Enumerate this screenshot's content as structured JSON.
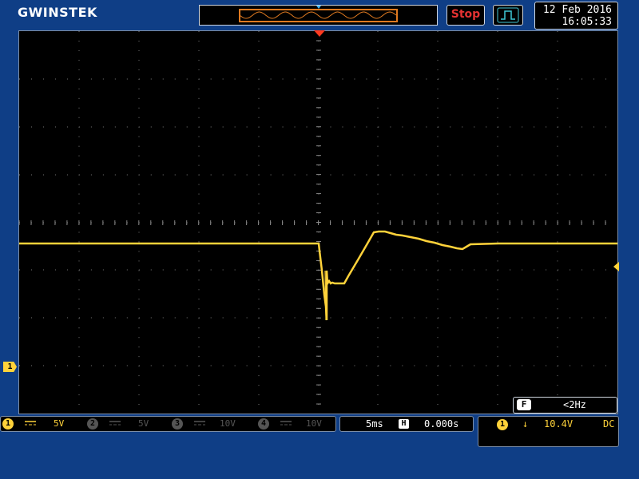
{
  "brand": {
    "logo_text": "GWINSTEK"
  },
  "run_state": {
    "label": "Stop",
    "color": "#e43232"
  },
  "trigger_mode_icon": "edge-trigger-icon",
  "datetime": {
    "date": "12 Feb 2016",
    "time": "16:05:33"
  },
  "frequency": {
    "icon_label": "F",
    "value": "<2Hz"
  },
  "channels": [
    {
      "num": "1",
      "coupling_icon": "dc-coupling-icon",
      "volts": "5V",
      "active": true,
      "color": "#ffd23a"
    },
    {
      "num": "2",
      "coupling_icon": "dc-coupling-icon",
      "volts": "5V",
      "active": false,
      "color": "#555555"
    },
    {
      "num": "3",
      "coupling_icon": "dc-coupling-icon",
      "volts": "10V",
      "active": false,
      "color": "#555555"
    },
    {
      "num": "4",
      "coupling_icon": "dc-coupling-icon",
      "volts": "10V",
      "active": false,
      "color": "#555555"
    }
  ],
  "timebase": {
    "scale": "5ms",
    "position_icon": "H",
    "position": "0.000s"
  },
  "trigger": {
    "source": "1",
    "slope_icon": "falling-edge-icon",
    "slope_glyph": "↓",
    "level": "10.4V",
    "coupling": "DC"
  },
  "ch1_marker": "1",
  "colors": {
    "trace": "#ffd23a",
    "trigger_marker": "#ff3a1f",
    "background": "#0f3e86"
  }
}
